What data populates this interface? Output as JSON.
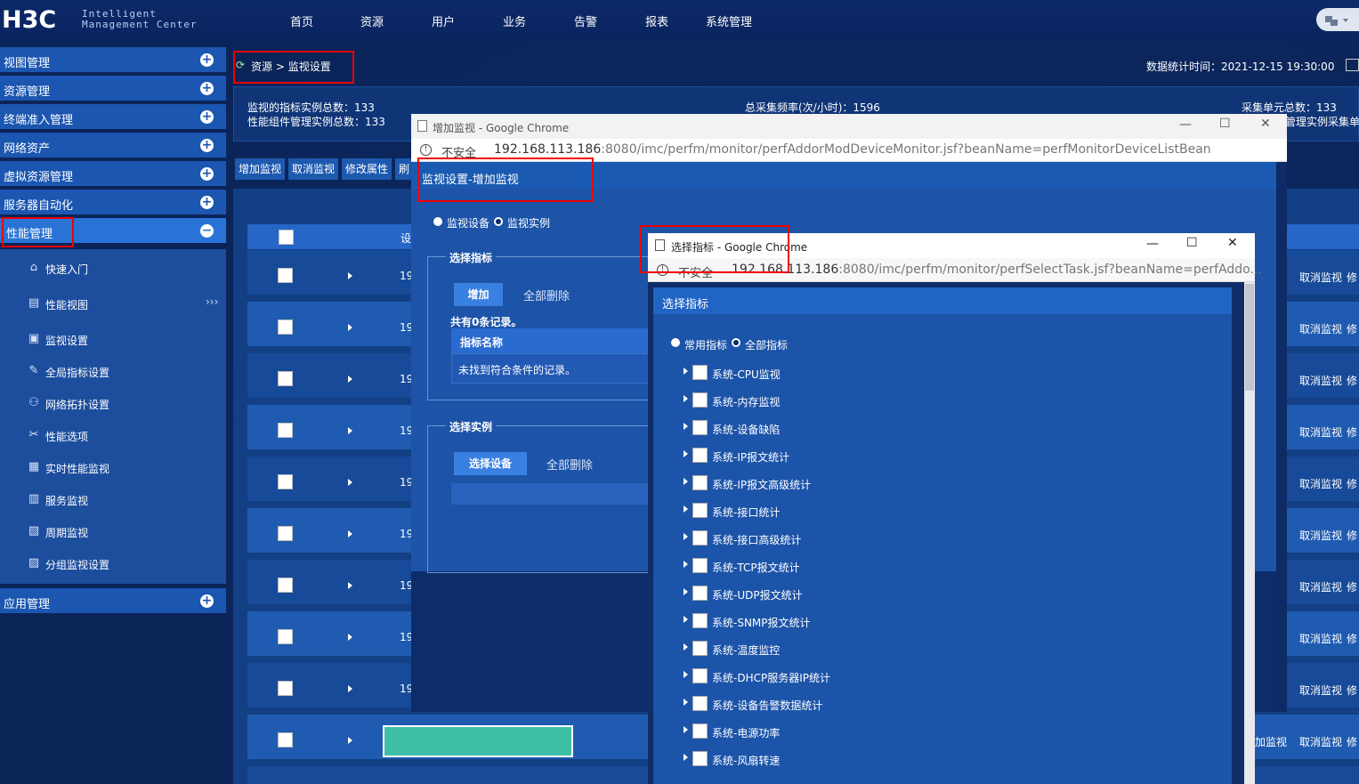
{
  "header": {
    "logo": "H3C",
    "logo_line1": "Intelligent",
    "logo_line2": "Management Center",
    "nav": [
      "首页",
      "资源",
      "用户",
      "业务",
      "告警",
      "报表",
      "系统管理"
    ]
  },
  "sidebar": {
    "groups": [
      {
        "label": "视图管理"
      },
      {
        "label": "资源管理"
      },
      {
        "label": "终端准入管理"
      },
      {
        "label": "网络资产"
      },
      {
        "label": "虚拟资源管理"
      },
      {
        "label": "服务器自动化"
      },
      {
        "label": "性能管理"
      }
    ],
    "sub_items": [
      {
        "label": "快速入门",
        "icon": "home-icon"
      },
      {
        "label": "性能视图",
        "icon": "view-icon"
      },
      {
        "label": "监视设置",
        "icon": "monitor-settings-icon"
      },
      {
        "label": "全局指标设置",
        "icon": "global-index-icon"
      },
      {
        "label": "网络拓扑设置",
        "icon": "topology-icon"
      },
      {
        "label": "性能选项",
        "icon": "wrench-icon"
      },
      {
        "label": "实时性能监视",
        "icon": "realtime-icon"
      },
      {
        "label": "服务监视",
        "icon": "service-icon"
      },
      {
        "label": "周期监视",
        "icon": "calendar-icon"
      },
      {
        "label": "分组监视设置",
        "icon": "group-icon"
      }
    ],
    "more_glyph": "›››",
    "app_management": "应用管理"
  },
  "breadcrumb": {
    "root": "资源",
    "sep": ">",
    "current": "监视设置"
  },
  "stats": {
    "time": "数据统计时间：2021-12-15 19:30:00",
    "line1": "监视的指标实例总数：133",
    "line2": "性能组件管理实例总数：133",
    "freq": "总采集频率(次/小时)：1596",
    "collect_units": "采集单元总数：133",
    "collect_units_2": "管理实例采集单"
  },
  "toolbar": [
    "增加监视",
    "取消监视",
    "修改属性",
    "刷"
  ],
  "list": {
    "header_col": "设",
    "ip_prefix": "19",
    "action_cancel": "取消监视",
    "action_modify": "修",
    "last_row_add": "加监视"
  },
  "win1": {
    "title": "增加监视 - Google Chrome",
    "insecure": "不安全",
    "url_host": "192.168.113.186",
    "url_path": ":8080/imc/perfm/monitor/perfAddorModDeviceMonitor.jsf?beanName=perfMonitorDeviceListBean",
    "panel_title": "监视设置-增加监视",
    "radio_device": "监视设备",
    "radio_instance": "监视实例",
    "fs_index": "选择指标",
    "btn_add": "增加",
    "btn_delete_all": "全部删除",
    "record_count": "共有0条记录。",
    "col_index_name": "指标名称",
    "empty_msg": "未找到符合条件的记录。",
    "fs_instance": "选择实例",
    "btn_select_device": "选择设备",
    "btn_delete_all_2": "全部删除"
  },
  "win2": {
    "title": "选择指标 - Google Chrome",
    "insecure": "不安全",
    "url_host": "192.168.113.186",
    "url_path": ":8080/imc/perfm/monitor/perfSelectTask.jsf?beanName=perfAddo...",
    "panel_title": "选择指标",
    "radio_common": "常用指标",
    "radio_all": "全部指标",
    "indicators": [
      "系统-CPU监视",
      "系统-内存监视",
      "系统-设备缺陷",
      "系统-IP报文统计",
      "系统-IP报文高级统计",
      "系统-接口统计",
      "系统-接口高级统计",
      "系统-TCP报文统计",
      "系统-UDP报文统计",
      "系统-SNMP报文统计",
      "系统-温度监控",
      "系统-DHCP服务器IP统计",
      "系统-设备告警数据统计",
      "系统-电源功率",
      "系统-风扇转速"
    ]
  },
  "colors": {
    "accent": "#1b56b0",
    "highlight_red": "#e00000",
    "teal": "#3fbfa8"
  }
}
